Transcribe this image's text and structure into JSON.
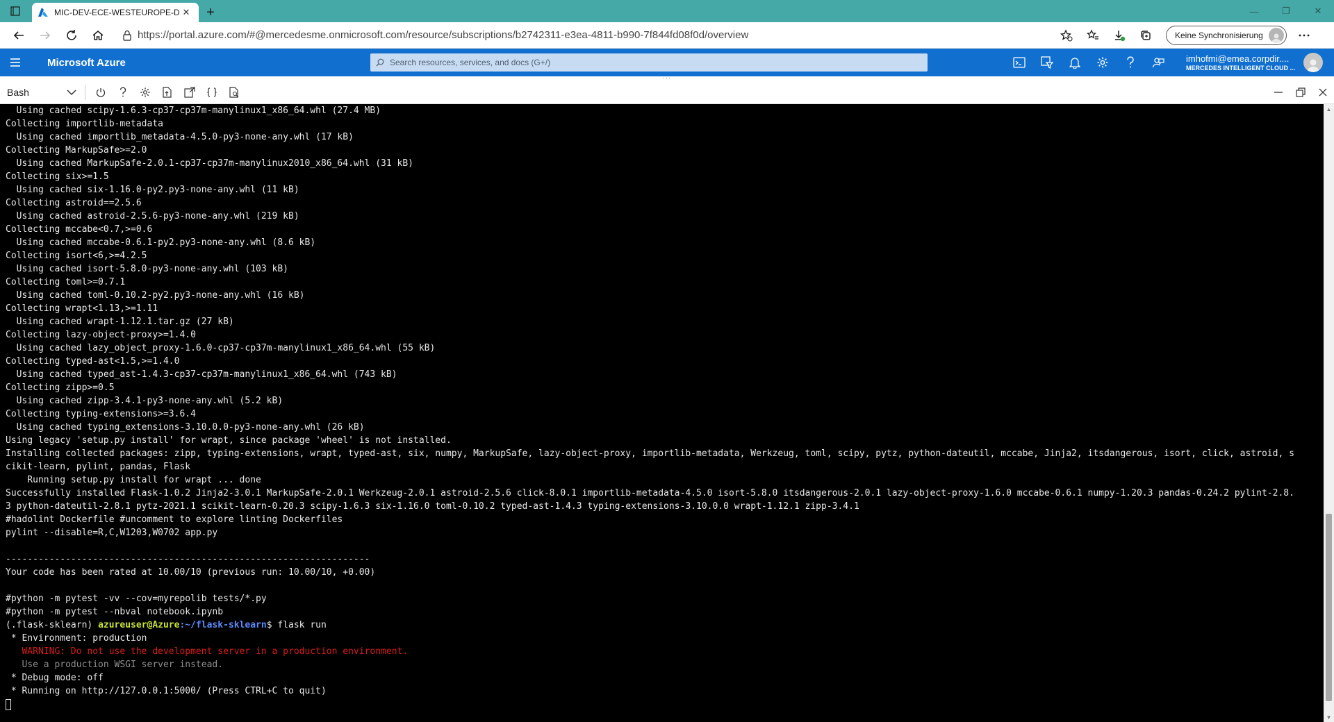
{
  "browser": {
    "tab_title": "MIC-DEV-ECE-WESTEUROPE-DD",
    "url": "https://portal.azure.com/#@mercedesme.onmicrosoft.com/resource/subscriptions/b2742311-e3ea-4811-b990-7f844fd08f0d/overview",
    "sync_label": "Keine Synchronisierung"
  },
  "azure": {
    "brand": "Microsoft Azure",
    "search_placeholder": "Search resources, services, and docs (G+/)",
    "user_email": "imhofmi@emea.corpdir....",
    "user_directory": "MERCEDES INTELLIGENT CLOUD ..."
  },
  "shell": {
    "selected_shell": "Bash"
  },
  "terminal": {
    "lines": [
      "  Using cached scipy-1.6.3-cp37-cp37m-manylinux1_x86_64.whl (27.4 MB)",
      "Collecting importlib-metadata",
      "  Using cached importlib_metadata-4.5.0-py3-none-any.whl (17 kB)",
      "Collecting MarkupSafe>=2.0",
      "  Using cached MarkupSafe-2.0.1-cp37-cp37m-manylinux2010_x86_64.whl (31 kB)",
      "Collecting six>=1.5",
      "  Using cached six-1.16.0-py2.py3-none-any.whl (11 kB)",
      "Collecting astroid==2.5.6",
      "  Using cached astroid-2.5.6-py3-none-any.whl (219 kB)",
      "Collecting mccabe<0.7,>=0.6",
      "  Using cached mccabe-0.6.1-py2.py3-none-any.whl (8.6 kB)",
      "Collecting isort<6,>=4.2.5",
      "  Using cached isort-5.8.0-py3-none-any.whl (103 kB)",
      "Collecting toml>=0.7.1",
      "  Using cached toml-0.10.2-py2.py3-none-any.whl (16 kB)",
      "Collecting wrapt<1.13,>=1.11",
      "  Using cached wrapt-1.12.1.tar.gz (27 kB)",
      "Collecting lazy-object-proxy>=1.4.0",
      "  Using cached lazy_object_proxy-1.6.0-cp37-cp37m-manylinux1_x86_64.whl (55 kB)",
      "Collecting typed-ast<1.5,>=1.4.0",
      "  Using cached typed_ast-1.4.3-cp37-cp37m-manylinux1_x86_64.whl (743 kB)",
      "Collecting zipp>=0.5",
      "  Using cached zipp-3.4.1-py3-none-any.whl (5.2 kB)",
      "Collecting typing-extensions>=3.6.4",
      "  Using cached typing_extensions-3.10.0.0-py3-none-any.whl (26 kB)",
      "Using legacy 'setup.py install' for wrapt, since package 'wheel' is not installed.",
      "Installing collected packages: zipp, typing-extensions, wrapt, typed-ast, six, numpy, MarkupSafe, lazy-object-proxy, importlib-metadata, Werkzeug, toml, scipy, pytz, python-dateutil, mccabe, Jinja2, itsdangerous, isort, click, astroid, s",
      "cikit-learn, pylint, pandas, Flask",
      "    Running setup.py install for wrapt ... done",
      "Successfully installed Flask-1.0.2 Jinja2-3.0.1 MarkupSafe-2.0.1 Werkzeug-2.0.1 astroid-2.5.6 click-8.0.1 importlib-metadata-4.5.0 isort-5.8.0 itsdangerous-2.0.1 lazy-object-proxy-1.6.0 mccabe-0.6.1 numpy-1.20.3 pandas-0.24.2 pylint-2.8.",
      "3 python-dateutil-2.8.1 pytz-2021.1 scikit-learn-0.20.3 scipy-1.6.3 six-1.16.0 toml-0.10.2 typed-ast-1.4.3 typing-extensions-3.10.0.0 wrapt-1.12.1 zipp-3.4.1",
      "#hadolint Dockerfile #uncomment to explore linting Dockerfiles",
      "pylint --disable=R,C,W1203,W0702 app.py",
      "",
      "-------------------------------------------------------------------",
      "Your code has been rated at 10.00/10 (previous run: 10.00/10, +0.00)",
      "",
      "#python -m pytest -vv --cov=myrepolib tests/*.py",
      "#python -m pytest --nbval notebook.ipynb"
    ],
    "prompt": {
      "venv": "(.flask-sklearn) ",
      "user_host": "azureuser@Azure",
      "path": ":~/flask-sklearn",
      "command": "$ flask run"
    },
    "output_lines": [
      {
        "text": " * Environment: production",
        "style": "normal"
      },
      {
        "text": "   WARNING: Do not use the development server in a production environment.",
        "style": "red"
      },
      {
        "text": "   Use a production WSGI server instead.",
        "style": "grey"
      },
      {
        "text": " * Debug mode: off",
        "style": "normal"
      },
      {
        "text": " * Running on http://127.0.0.1:5000/ (Press CTRL+C to quit)",
        "style": "normal"
      }
    ]
  },
  "colors": {
    "tabbar": "#45a9a8",
    "azure_blue": "#1170cf",
    "prompt_user": "#c6e33a",
    "prompt_path": "#5c8cff",
    "warning_red": "#d81b1b"
  }
}
